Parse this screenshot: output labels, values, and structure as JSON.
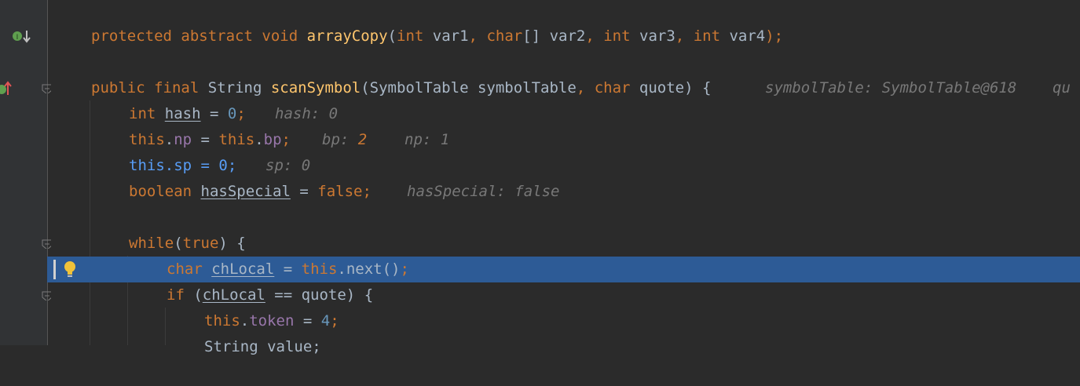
{
  "editor": {
    "lines": [
      {
        "tokens": [
          "protected",
          "abstract",
          "void",
          "arrayCopy",
          "(",
          "int",
          "var1",
          ",",
          "char",
          "[]",
          "var2",
          ",",
          "int",
          "var3",
          ",",
          "int",
          "var4",
          ");"
        ]
      },
      {
        "tokens": [
          "public",
          "final",
          "String",
          "scanSymbol",
          "(SymbolTable symbolTable",
          ",",
          "char",
          "quote) {"
        ],
        "hint": "symbolTable: SymbolTable@618    qu"
      },
      {
        "tokens": [
          "int",
          "hash",
          " = ",
          "0",
          ";"
        ],
        "hint": "hash: 0"
      },
      {
        "tokens": [
          "this",
          ".",
          "np",
          " = ",
          "this",
          ".",
          "bp",
          ";"
        ],
        "hints": [
          "bp: 2",
          "np: 1"
        ],
        "hint_value_1": "2"
      },
      {
        "tokens": [
          "this.sp = 0;"
        ],
        "hint": "sp: 0"
      },
      {
        "tokens": [
          "boolean",
          "hasSpecial",
          " = ",
          "false",
          ";"
        ],
        "hint": "hasSpecial: false"
      },
      {
        "tokens": [
          "while",
          "(",
          "true",
          ") {"
        ]
      },
      {
        "tokens": [
          "char",
          "chLocal",
          " = ",
          "this",
          ".next()",
          ";"
        ]
      },
      {
        "tokens": [
          "if",
          " (",
          "chLocal",
          " == quote) {"
        ]
      },
      {
        "tokens": [
          "this",
          ".",
          "token",
          " = ",
          "4",
          ";"
        ]
      },
      {
        "tokens": [
          "String value;"
        ]
      }
    ]
  },
  "gutter_icons": {
    "line1": "implementation-down-icon",
    "line2": "override-up-icon",
    "current": "lightbulb-icon"
  },
  "colors": {
    "background": "#2b2b2b",
    "execution_line": "#2d5b96",
    "keyword": "#cc7832",
    "function": "#ffc66d",
    "number": "#6897bb",
    "field": "#9876aa",
    "text": "#a9b7c6",
    "hint": "#787878"
  }
}
